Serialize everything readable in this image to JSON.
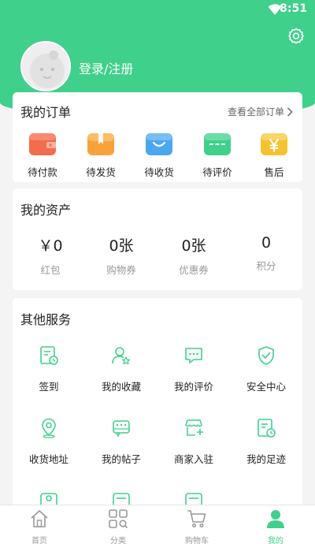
{
  "status_bar": {
    "time": "8:51"
  },
  "profile": {
    "login_label": "登录/注册",
    "settings_icon": "gear-icon",
    "avatar_icon": "default-avatar"
  },
  "orders": {
    "title": "我的订单",
    "view_all": "查看全部订单",
    "items": [
      {
        "label": "待付款",
        "icon": "wallet-icon",
        "color": "#f46b4e"
      },
      {
        "label": "待发货",
        "icon": "package-icon",
        "color": "#f9a23b"
      },
      {
        "label": "待收货",
        "icon": "basket-icon",
        "color": "#4ba7f0"
      },
      {
        "label": "待评价",
        "icon": "comment-card-icon",
        "color": "#3fd08c"
      },
      {
        "label": "售后",
        "icon": "yen-icon",
        "color": "#f6c22f"
      }
    ]
  },
  "assets": {
    "title": "我的资产",
    "items": [
      {
        "value": "￥0",
        "label": "红包"
      },
      {
        "value": "0张",
        "label": "购物券"
      },
      {
        "value": "0张",
        "label": "优惠券"
      },
      {
        "value": "0",
        "label": "积分"
      }
    ]
  },
  "services": {
    "title": "其他服务",
    "items": [
      {
        "label": "签到",
        "icon": "calendar-check-icon"
      },
      {
        "label": "我的收藏",
        "icon": "user-star-icon"
      },
      {
        "label": "我的评价",
        "icon": "chat-bubble-icon"
      },
      {
        "label": "安全中心",
        "icon": "shield-check-icon"
      },
      {
        "label": "收货地址",
        "icon": "location-pin-icon"
      },
      {
        "label": "我的帖子",
        "icon": "post-icon"
      },
      {
        "label": "商家入驻",
        "icon": "store-add-icon"
      },
      {
        "label": "我的足迹",
        "icon": "history-doc-icon"
      }
    ]
  },
  "tabbar": {
    "items": [
      {
        "label": "首页",
        "icon": "home-icon",
        "active": false
      },
      {
        "label": "分类",
        "icon": "grid-search-icon",
        "active": false
      },
      {
        "label": "购物车",
        "icon": "cart-icon",
        "active": false
      },
      {
        "label": "我的",
        "icon": "person-icon",
        "active": true
      }
    ]
  },
  "colors": {
    "accent": "#3fd08c",
    "muted": "#999999"
  }
}
